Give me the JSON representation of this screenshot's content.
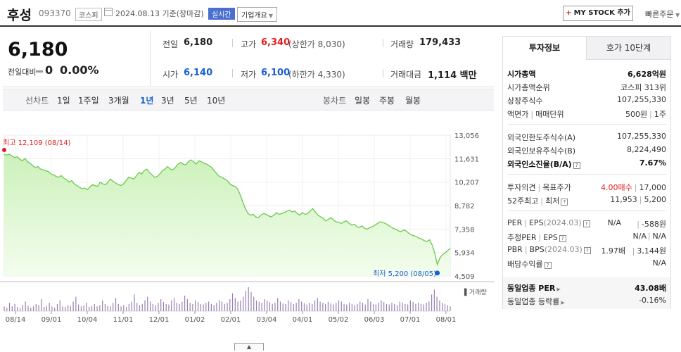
{
  "header": {
    "name": "후성",
    "code": "093370",
    "market": "코스피",
    "date": "2024.08.13 기준(장마감)",
    "realtime": "실시간",
    "company_overview": "기업개요",
    "my_stock": "MY STOCK 추가",
    "quick_order": "빠른주문"
  },
  "price": {
    "current": "6,180",
    "diff_label": "전일대비",
    "diff": "0",
    "diff_pct": "0.00%",
    "prev_label": "전일",
    "prev": "6,180",
    "high_label": "고가",
    "high": "6,340",
    "upper_limit": "(상한가 8,030)",
    "volume_label": "거래량",
    "volume": "179,433",
    "open_label": "시가",
    "open": "6,140",
    "low_label": "저가",
    "low": "6,100",
    "lower_limit": "(하한가 4,330)",
    "amount_label": "거래대금",
    "amount": "1,114 백만"
  },
  "period": {
    "line_label": "선차트",
    "line": [
      "1일",
      "1주일",
      "3개월",
      "1년",
      "3년",
      "5년",
      "10년"
    ],
    "active": "1년",
    "candle_label": "봉차트",
    "candle": [
      "일봉",
      "주봉",
      "월봉"
    ]
  },
  "chart_data": {
    "type": "area",
    "title": "",
    "y_ticks": [
      "13,056",
      "11,631",
      "10,207",
      "8,782",
      "7,358",
      "5,934",
      "4,509"
    ],
    "ylim": [
      4509,
      13056
    ],
    "x_ticks": [
      "08/14",
      "09/01",
      "10/04",
      "11/01",
      "12/01",
      "01/02",
      "02/01",
      "03/04",
      "04/01",
      "05/02",
      "06/03",
      "07/01",
      "08/01"
    ],
    "max_label": "최고 12,109 (08/14)",
    "min_label": "최저 5,200 (08/05)",
    "volume_legend": "거래량",
    "line_color": "#6cc94e",
    "max_color": "#e02020",
    "min_color": "#1a5fcf",
    "series": [
      {
        "values": [
          11900,
          11850,
          11900,
          11800,
          11700,
          11750,
          11600,
          11500,
          11650,
          11450,
          11350,
          11200,
          11100,
          11150,
          11000,
          10950,
          10900,
          10850,
          10700,
          10650,
          10550,
          10500,
          10600,
          10450,
          10350,
          10200,
          10300,
          10100,
          10000,
          9900,
          9800,
          9850,
          9750,
          9900,
          10050,
          10000,
          9950,
          10200,
          10100,
          10050,
          10200,
          10400,
          10250,
          10150,
          10050,
          10000,
          10100,
          10300,
          10500,
          10450,
          10400,
          10600,
          10800,
          10700,
          10900,
          11000,
          10800,
          10650,
          10500,
          10550,
          10700,
          10900,
          11000,
          11150,
          11000,
          10950,
          11100,
          11300,
          11400,
          11300,
          11250,
          11450,
          11550,
          11450,
          11300,
          11500,
          11450,
          11350,
          11300,
          11200,
          11100,
          10900,
          10700,
          10550,
          10500,
          10400,
          10300,
          10100,
          10000,
          9950,
          9800,
          9450,
          9000,
          8600,
          8300,
          8200,
          8250,
          8100,
          8050,
          8200,
          8300,
          8250,
          8150,
          8100,
          8200,
          8350,
          8250,
          8300,
          8350,
          8450,
          8500,
          8400,
          8450,
          8300,
          8200,
          8350,
          8250,
          8300,
          8450,
          8600,
          8400,
          8200,
          8100,
          8000,
          7850,
          7950,
          8050,
          7900,
          7800,
          7750,
          7700,
          7800,
          7850,
          7700,
          7600,
          7650,
          7500,
          7450,
          7550,
          7400,
          7350,
          7450,
          7500,
          7600,
          7700,
          7800,
          7750,
          7700,
          7600,
          7500,
          7400,
          7350,
          7250,
          7200,
          7300,
          7250,
          7100,
          7000,
          6950,
          6900,
          6800,
          6750,
          6650,
          6600,
          6700,
          6400,
          5900,
          5200,
          5600,
          5800,
          5900,
          6050,
          6180
        ]
      }
    ],
    "volume": [
      0.2,
      0.15,
      0.35,
      0.2,
      0.3,
      0.18,
      0.12,
      0.25,
      0.4,
      0.22,
      0.15,
      0.2,
      0.3,
      0.25,
      0.5,
      0.18,
      0.22,
      0.35,
      0.2,
      0.15,
      0.3,
      0.45,
      0.2,
      0.18,
      0.25,
      0.22,
      0.4,
      0.6,
      0.28,
      0.2,
      0.25,
      0.35,
      0.18,
      0.22,
      0.3,
      0.2,
      0.25,
      0.45,
      0.3,
      0.22,
      0.2,
      0.35,
      0.55,
      0.3,
      0.2,
      0.25,
      0.18,
      0.3,
      0.4,
      0.7,
      0.35,
      0.25,
      0.3,
      0.45,
      0.6,
      0.4,
      0.3,
      0.25,
      0.35,
      0.5,
      0.38,
      0.3,
      0.28,
      0.45,
      0.55,
      0.35,
      0.3,
      0.4,
      0.65,
      0.5,
      0.35,
      0.3,
      0.45,
      0.38,
      0.3,
      0.28,
      0.35,
      0.4,
      0.3,
      0.25,
      0.35,
      0.45,
      0.4,
      0.3,
      0.35,
      0.5,
      0.75,
      0.55,
      0.4,
      0.45,
      0.6,
      0.85,
      1.0,
      0.8,
      0.6,
      0.45,
      0.4,
      0.35,
      0.5,
      0.45,
      0.38,
      0.3,
      0.35,
      0.55,
      0.4,
      0.32,
      0.3,
      0.45,
      0.38,
      0.3,
      0.35,
      0.5,
      0.4,
      0.33,
      0.28,
      0.35,
      0.3,
      0.45,
      0.55,
      0.4,
      0.35,
      0.3,
      0.38,
      0.32,
      0.28,
      0.35,
      0.45,
      0.4,
      0.3,
      0.28,
      0.35,
      0.3,
      0.25,
      0.3,
      0.4,
      0.35,
      0.28,
      0.5,
      0.4,
      0.3,
      0.28,
      0.35,
      0.45,
      0.38,
      0.3,
      0.28,
      0.35,
      0.3,
      0.25,
      0.4,
      0.35,
      0.3,
      0.28,
      0.45,
      0.38,
      0.3,
      0.35,
      0.3,
      0.28,
      0.35,
      0.4,
      0.7,
      0.9,
      0.6,
      0.45,
      0.35,
      0.3,
      0.25,
      0.2
    ]
  },
  "side": {
    "tabs": [
      "투자정보",
      "호가 10단계"
    ],
    "market_cap_label": "시가총액",
    "market_cap": "6,628억원",
    "cap_rank_label": "시가총액순위",
    "cap_rank": "코스피 313위",
    "shares_label": "상장주식수",
    "shares": "107,255,330",
    "par_label": "액면가",
    "trade_unit_label": "매매단위",
    "par": "500원",
    "trade_unit": "1주",
    "foreign_limit_label": "외국인한도주식수(A)",
    "foreign_limit": "107,255,330",
    "foreign_hold_label": "외국인보유주식수(B)",
    "foreign_hold": "8,224,490",
    "foreign_ratio_label": "외국인소진율(B/A)",
    "foreign_ratio": "7.67%",
    "opinion_label": "투자의견",
    "target_label": "목표주가",
    "opinion": "4.00매수",
    "target": "17,000",
    "w52_label": "52주최고",
    "w52_low_label": "최저",
    "w52_high": "11,953",
    "w52_low": "5,200",
    "per_label": "PER",
    "eps_label": "EPS",
    "eps_period": "(2024.03)",
    "per": "N/A",
    "eps": "-588원",
    "est_per_label": "추정PER",
    "est_eps_label": "EPS",
    "est_per": "N/A",
    "est_eps": "N/A",
    "pbr_label": "PBR",
    "bps_label": "BPS",
    "bps_period": "(2024.03)",
    "pbr": "1.97배",
    "bps": "3,144원",
    "div_label": "배당수익률",
    "div": "N/A",
    "ind_per_label": "동일업종 PER",
    "ind_per": "43.08배",
    "ind_rate_label": "동일업종 등락률",
    "ind_rate": "-0.16%"
  }
}
